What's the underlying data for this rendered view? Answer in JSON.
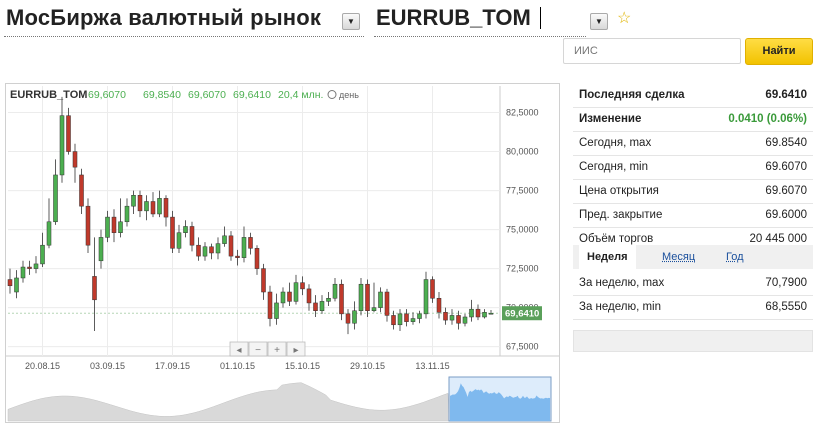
{
  "header": {
    "title": "МосБиржа валютный рынок",
    "ticker": "EURRUB_TOM"
  },
  "search": {
    "placeholder": "ИИС",
    "button_label": "Найти"
  },
  "chart_header": {
    "ticker": "EURRUB_TOM",
    "open": "69,6070",
    "high": "69,8540",
    "low": "69,6070",
    "close": "69,6410",
    "volume": "20,4 млн.",
    "period": "день"
  },
  "price_tag": "69,6410",
  "nav_buttons": [
    "◂",
    "−",
    "+",
    "▸"
  ],
  "chart_data": {
    "type": "candlestick",
    "y_ticks": [
      "82,5000",
      "80,0000",
      "77,5000",
      "75,0000",
      "72,5000",
      "70,0000",
      "67,5000"
    ],
    "y_tick_values": [
      82.5,
      80,
      77.5,
      75,
      72.5,
      70,
      67.5
    ],
    "ylim": [
      66.9,
      84.2
    ],
    "x_ticks": [
      "20.08.15",
      "03.09.15",
      "17.09.15",
      "01.10.15",
      "15.10.15",
      "29.10.15",
      "13.11.15"
    ],
    "candles": [
      [
        71.8,
        71.4,
        72.5,
        70.9
      ],
      [
        71.0,
        71.9,
        72.4,
        70.6
      ],
      [
        71.9,
        72.6,
        73.0,
        71.6
      ],
      [
        72.6,
        72.5,
        73.0,
        72.1
      ],
      [
        72.5,
        72.8,
        73.3,
        72.2
      ],
      [
        72.8,
        74.0,
        74.8,
        72.6
      ],
      [
        74.0,
        75.5,
        77.0,
        73.8
      ],
      [
        75.5,
        78.5,
        79.5,
        75.3
      ],
      [
        78.5,
        82.3,
        83.5,
        78.0
      ],
      [
        82.3,
        80.0,
        82.8,
        79.8
      ],
      [
        80.0,
        79.0,
        80.5,
        78.0
      ],
      [
        78.5,
        76.5,
        78.9,
        76.0
      ],
      [
        76.5,
        74.0,
        77.0,
        73.5
      ],
      [
        72.0,
        70.5,
        74.5,
        68.5
      ],
      [
        73.0,
        74.5,
        75.0,
        72.5
      ],
      [
        74.5,
        75.8,
        76.2,
        74.2
      ],
      [
        75.8,
        74.8,
        76.3,
        74.2
      ],
      [
        74.8,
        75.5,
        77.0,
        74.5
      ],
      [
        75.5,
        76.5,
        77.0,
        75.2
      ],
      [
        76.5,
        77.2,
        77.5,
        76.0
      ],
      [
        77.2,
        76.2,
        77.5,
        75.8
      ],
      [
        76.2,
        76.8,
        77.2,
        75.6
      ],
      [
        76.8,
        76.0,
        77.4,
        75.8
      ],
      [
        76.0,
        77.0,
        77.5,
        75.8
      ],
      [
        77.0,
        75.8,
        77.2,
        75.2
      ],
      [
        75.8,
        73.8,
        76.2,
        73.5
      ],
      [
        73.8,
        74.8,
        75.3,
        73.5
      ],
      [
        74.8,
        75.2,
        75.6,
        74.5
      ],
      [
        75.2,
        74.0,
        75.5,
        73.6
      ],
      [
        74.0,
        73.3,
        74.5,
        73.0
      ],
      [
        73.3,
        73.9,
        74.2,
        73.0
      ],
      [
        73.9,
        73.5,
        74.1,
        73.1
      ],
      [
        73.5,
        74.1,
        74.5,
        73.1
      ],
      [
        74.1,
        74.6,
        75.2,
        73.9
      ],
      [
        74.6,
        73.3,
        74.9,
        73.0
      ],
      [
        73.3,
        73.2,
        73.7,
        72.7
      ],
      [
        73.2,
        74.5,
        75.2,
        72.9
      ],
      [
        74.5,
        73.8,
        74.8,
        73.4
      ],
      [
        73.8,
        72.5,
        74.0,
        72.1
      ],
      [
        72.5,
        71.0,
        72.8,
        70.5
      ],
      [
        71.0,
        69.3,
        71.4,
        68.8
      ],
      [
        69.3,
        70.3,
        70.9,
        68.9
      ],
      [
        70.3,
        71.0,
        71.3,
        70.0
      ],
      [
        71.0,
        70.4,
        71.6,
        70.1
      ],
      [
        70.4,
        71.6,
        72.1,
        70.2
      ],
      [
        71.6,
        71.2,
        72.0,
        70.8
      ],
      [
        71.2,
        70.3,
        71.5,
        69.8
      ],
      [
        70.3,
        69.8,
        70.8,
        69.4
      ],
      [
        69.8,
        70.4,
        70.8,
        69.6
      ],
      [
        70.4,
        70.6,
        71.0,
        70.1
      ],
      [
        70.6,
        71.5,
        71.9,
        70.4
      ],
      [
        71.5,
        69.6,
        71.8,
        69.2
      ],
      [
        69.6,
        69.0,
        69.9,
        68.3
      ],
      [
        69.0,
        69.8,
        70.4,
        68.6
      ],
      [
        69.8,
        71.5,
        71.9,
        69.5
      ],
      [
        71.5,
        69.8,
        71.8,
        69.4
      ],
      [
        69.8,
        70.0,
        71.6,
        69.7
      ],
      [
        70.0,
        71.0,
        71.3,
        69.7
      ],
      [
        71.0,
        69.5,
        71.2,
        69.1
      ],
      [
        69.5,
        68.9,
        69.8,
        68.6
      ],
      [
        68.9,
        69.6,
        69.9,
        68.5
      ],
      [
        69.6,
        69.1,
        69.9,
        68.8
      ],
      [
        69.1,
        69.3,
        69.7,
        68.9
      ],
      [
        69.3,
        69.6,
        69.8,
        69.0
      ],
      [
        69.6,
        71.8,
        72.3,
        69.3
      ],
      [
        71.8,
        70.6,
        72.0,
        70.3
      ],
      [
        70.6,
        69.7,
        71.0,
        69.3
      ],
      [
        69.7,
        69.2,
        70.0,
        68.9
      ],
      [
        69.2,
        69.5,
        69.9,
        68.9
      ],
      [
        69.5,
        69.0,
        69.8,
        68.6
      ],
      [
        69.0,
        69.4,
        69.6,
        68.8
      ],
      [
        69.4,
        69.9,
        70.5,
        69.1
      ],
      [
        69.9,
        69.4,
        70.2,
        69.2
      ],
      [
        69.4,
        69.7,
        69.9,
        69.3
      ],
      [
        69.6,
        69.64,
        69.85,
        69.6
      ]
    ],
    "colors": {
      "up": "#4caf50",
      "down": "#c0392b",
      "price_tag": "#5aa05a"
    }
  },
  "quote_table": [
    {
      "label": "Последняя сделка",
      "value": "69.6410",
      "bold": true
    },
    {
      "label": "Изменение",
      "value": "0.0410 (0.06%)",
      "bold": true,
      "green": true
    },
    {
      "label": "Сегодня, max",
      "value": "69.8540"
    },
    {
      "label": "Сегодня, min",
      "value": "69.6070"
    },
    {
      "label": "Цена открытия",
      "value": "69.6070"
    },
    {
      "label": "Пред. закрытие",
      "value": "69.6000"
    },
    {
      "label": "Объём торгов",
      "value": "20 445 000"
    }
  ],
  "period_tabs": [
    "Неделя",
    "Месяц",
    "Год"
  ],
  "week_table": [
    {
      "label": "За неделю, max",
      "value": "70,7900"
    },
    {
      "label": "За неделю, min",
      "value": "68,5550"
    }
  ]
}
